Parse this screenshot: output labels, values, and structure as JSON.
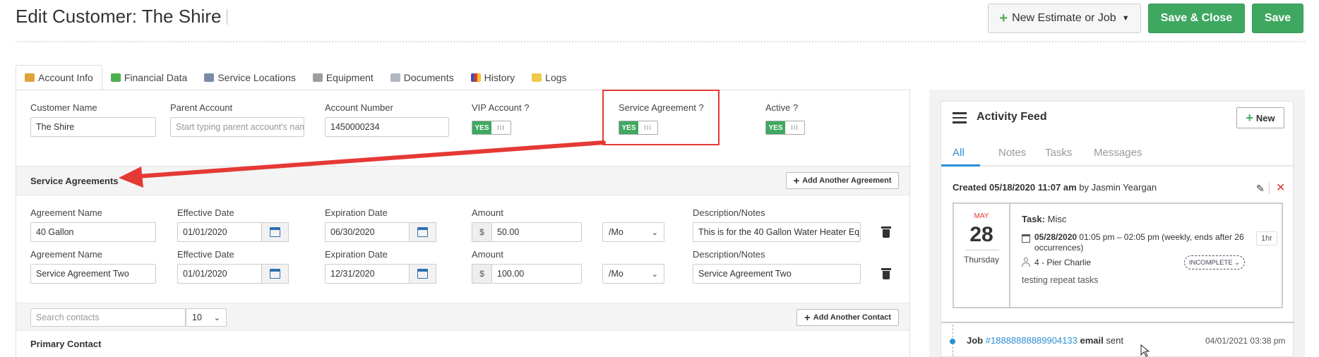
{
  "header": {
    "title": "Edit Customer: The Shire",
    "new_estimate_label": "New Estimate or Job",
    "save_close_label": "Save & Close",
    "save_label": "Save"
  },
  "tabs": [
    {
      "label": "Account Info",
      "icon": "users-icon",
      "active": true
    },
    {
      "label": "Financial Data",
      "icon": "money-icon"
    },
    {
      "label": "Service Locations",
      "icon": "location-icon"
    },
    {
      "label": "Equipment",
      "icon": "equipment-icon"
    },
    {
      "label": "Documents",
      "icon": "document-icon"
    },
    {
      "label": "History",
      "icon": "chart-icon"
    },
    {
      "label": "Logs",
      "icon": "envelope-icon"
    }
  ],
  "account": {
    "customer_name_label": "Customer Name",
    "customer_name": "The Shire",
    "parent_account_label": "Parent Account",
    "parent_account_placeholder": "Start typing parent account's nam",
    "account_number_label": "Account Number",
    "account_number": "1450000234",
    "vip_label": "VIP Account ?",
    "service_agreement_label": "Service Agreement ?",
    "active_label": "Active ?",
    "toggle_yes": "YES",
    "toggle_handle": "III"
  },
  "agreements": {
    "section_title": "Service Agreements",
    "add_label": "Add Another Agreement",
    "labels": {
      "name": "Agreement Name",
      "effective": "Effective Date",
      "expiration": "Expiration Date",
      "amount": "Amount",
      "notes": "Description/Notes"
    },
    "currency": "$",
    "rows": [
      {
        "name": "40 Gallon",
        "effective": "01/01/2020",
        "expiration": "06/30/2020",
        "amount": "50.00",
        "period": "/Mo",
        "notes": "This is for the 40 Gallon Water Heater Eq"
      },
      {
        "name": "Service Agreement Two",
        "effective": "01/01/2020",
        "expiration": "12/31/2020",
        "amount": "100.00",
        "period": "/Mo",
        "notes": "Service Agreement Two"
      }
    ]
  },
  "contacts": {
    "search_placeholder": "Search contacts",
    "page_size": "10",
    "add_label": "Add Another Contact",
    "primary_title": "Primary Contact"
  },
  "feed": {
    "title": "Activity Feed",
    "new_label": "New",
    "tabs": [
      "All",
      "Notes",
      "Tasks",
      "Messages"
    ],
    "created_prefix": "Created 05/18/2020 11:07 am",
    "created_by_word": "by",
    "created_by": "Jasmin Yeargan",
    "card": {
      "month": "MAY",
      "day": "28",
      "weekday": "Thursday",
      "task_label": "Task:",
      "task_name": "Misc",
      "date": "05/28/2020",
      "when": "01:05 pm – 02:05 pm (weekly, ends after 26 occurrences)",
      "duration": "1hr",
      "assignee": "4 - Pier Charlie",
      "status": "INCOMPLETE",
      "note": "testing repeat tasks"
    },
    "job": {
      "prefix": "Job",
      "number": "#18888888889904133",
      "kind": "email",
      "verb": "sent",
      "time": "04/01/2021 03:38 pm"
    }
  },
  "colors": {
    "green": "#3fa860",
    "blue": "#2d8fd5",
    "red": "#e53935"
  }
}
